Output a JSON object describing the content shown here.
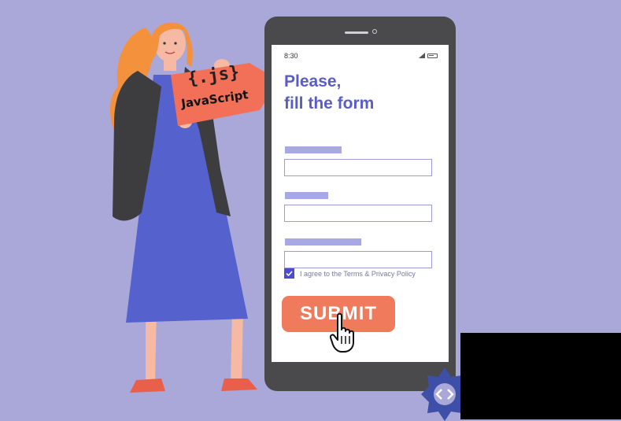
{
  "phone": {
    "status_time": "8:30",
    "heading_line1": "Please,",
    "heading_line2": "fill the form",
    "agree_text": "I agree to the Terms & Privacy Policy",
    "agree_checked": true,
    "submit_label": "SUBMIT"
  },
  "sign": {
    "title": "{.js}",
    "subtitle": "JavaScript"
  },
  "colors": {
    "background": "#a9a8d9",
    "accent": "#5a5cc7",
    "submit": "#f07a5c",
    "sign": "#f27058",
    "hair": "#f3913d",
    "dress": "#5561cc",
    "jacket": "#3d3d40"
  },
  "icons": [
    "pointer-hand-icon",
    "check-icon",
    "signal-icon",
    "battery-icon",
    "camera-icon"
  ]
}
